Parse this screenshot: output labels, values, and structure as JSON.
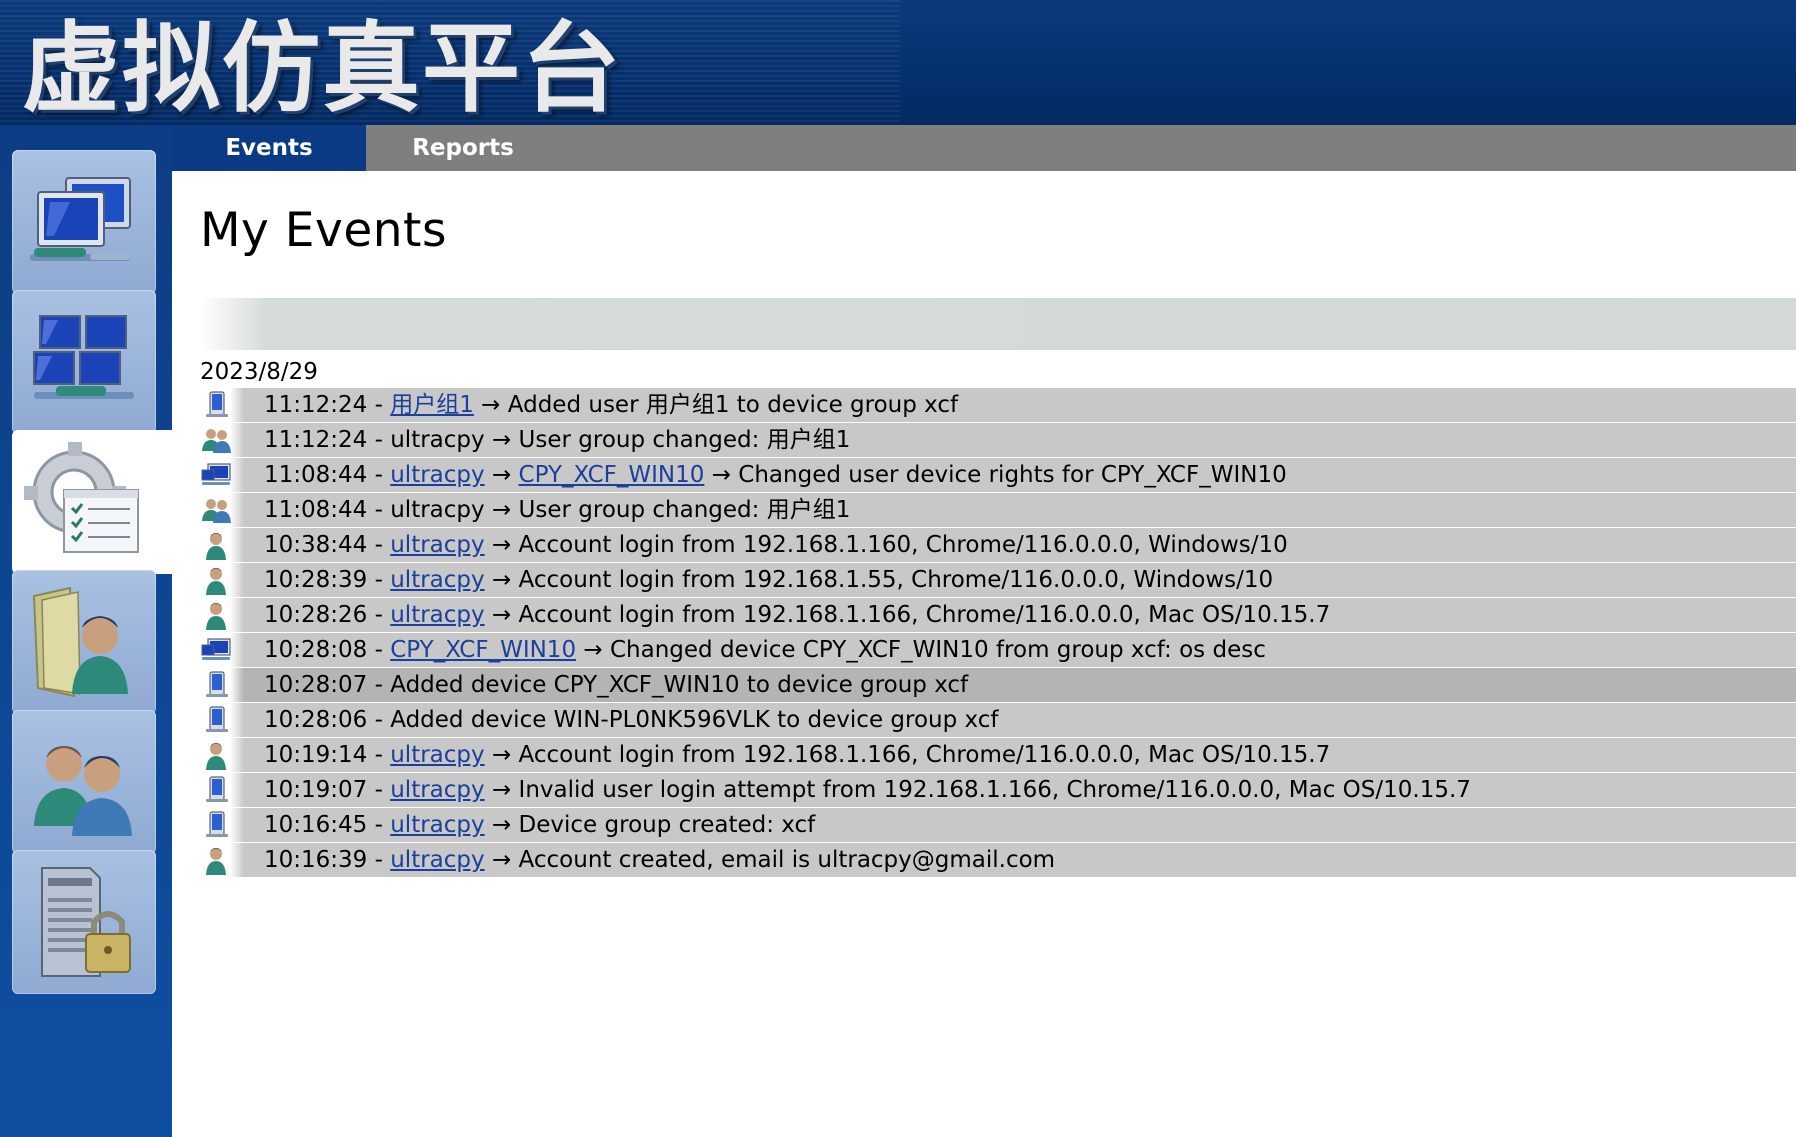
{
  "app": {
    "title": "虚拟仿真平台"
  },
  "tabs": [
    {
      "label": "Events",
      "active": true
    },
    {
      "label": "Reports",
      "active": false
    }
  ],
  "sidebar": {
    "items": [
      {
        "icon": "network-computers-icon",
        "active": false
      },
      {
        "icon": "computer-group-icon",
        "active": false
      },
      {
        "icon": "settings-checklist-icon",
        "active": true
      },
      {
        "icon": "user-folder-icon",
        "active": false
      },
      {
        "icon": "users-icon",
        "active": false
      },
      {
        "icon": "server-lock-icon",
        "active": false
      }
    ]
  },
  "main": {
    "title": "My Events",
    "date": "2023/8/29",
    "events": [
      {
        "icon": "device-icon",
        "time": "11:12:24",
        "link1": "用户组1",
        "link2": "",
        "message": "Added user 用户组1 to device group xcf"
      },
      {
        "icon": "user-group-icon",
        "time": "11:12:24",
        "actor": "ultracpy",
        "link1": "",
        "link2": "",
        "message": "User group changed: 用户组1"
      },
      {
        "icon": "computer-icon",
        "time": "11:08:44",
        "link1": "ultracpy",
        "link2": "CPY_XCF_WIN10",
        "message": "Changed user device rights for CPY_XCF_WIN10"
      },
      {
        "icon": "user-group-icon",
        "time": "11:08:44",
        "actor": "ultracpy",
        "link1": "",
        "link2": "",
        "message": "User group changed: 用户组1"
      },
      {
        "icon": "user-icon",
        "time": "10:38:44",
        "link1": "ultracpy",
        "link2": "",
        "message": "Account login from 192.168.1.160, Chrome/116.0.0.0, Windows/10"
      },
      {
        "icon": "user-icon",
        "time": "10:28:39",
        "link1": "ultracpy",
        "link2": "",
        "message": "Account login from 192.168.1.55, Chrome/116.0.0.0, Windows/10"
      },
      {
        "icon": "user-icon",
        "time": "10:28:26",
        "link1": "ultracpy",
        "link2": "",
        "message": "Account login from 192.168.1.166, Chrome/116.0.0.0, Mac OS/10.15.7"
      },
      {
        "icon": "computer-icon",
        "time": "10:28:08",
        "link1": "CPY_XCF_WIN10",
        "link2": "",
        "message": "Changed device CPY_XCF_WIN10 from group xcf: os desc"
      },
      {
        "icon": "device-icon",
        "time": "10:28:07",
        "plain": "Added device CPY_XCF_WIN10 to device group xcf",
        "highlight": true
      },
      {
        "icon": "device-icon",
        "time": "10:28:06",
        "plain": "Added device WIN-PL0NK596VLK to device group xcf"
      },
      {
        "icon": "user-icon",
        "time": "10:19:14",
        "link1": "ultracpy",
        "link2": "",
        "message": "Account login from 192.168.1.166, Chrome/116.0.0.0, Mac OS/10.15.7"
      },
      {
        "icon": "device-icon",
        "time": "10:19:07",
        "link1": "ultracpy",
        "link2": "",
        "message": "Invalid user login attempt from 192.168.1.166, Chrome/116.0.0.0, Mac OS/10.15.7"
      },
      {
        "icon": "device-icon",
        "time": "10:16:45",
        "link1": "ultracpy",
        "link2": "",
        "message": "Device group created: xcf"
      },
      {
        "icon": "user-icon",
        "time": "10:16:39",
        "link1": "ultracpy",
        "link2": "",
        "message": "Account created, email is ultracpy@gmail.com"
      }
    ]
  }
}
